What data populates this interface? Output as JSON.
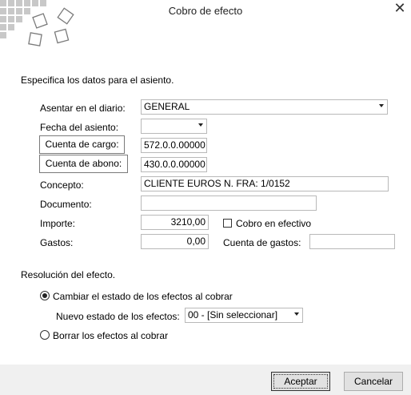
{
  "window": {
    "title": "Cobro de efecto",
    "close_icon": "close-icon"
  },
  "section1": {
    "heading": "Especifica los datos para el asiento."
  },
  "form": {
    "diario": {
      "label": "Asentar en el diario:",
      "value": "GENERAL"
    },
    "fecha": {
      "label": "Fecha del asiento:",
      "value": ""
    },
    "cargo": {
      "label": "Cuenta de cargo:",
      "value": "572.0.0.00000"
    },
    "abono": {
      "label": "Cuenta de abono:",
      "value": "430.0.0.00000"
    },
    "concepto": {
      "label": "Concepto:",
      "value": "CLIENTE EUROS N. FRA: 1/0152"
    },
    "documento": {
      "label": "Documento:",
      "value": ""
    },
    "importe": {
      "label": "Importe:",
      "value": "3210,00"
    },
    "cobro_efectivo": {
      "label": "Cobro en efectivo",
      "checked": false
    },
    "gastos": {
      "label": "Gastos:",
      "value": "0,00"
    },
    "cuenta_gastos": {
      "label": "Cuenta de gastos:",
      "value": ""
    }
  },
  "section2": {
    "heading": "Resolución del efecto.",
    "option_change": {
      "label": "Cambiar el estado de los efectos al cobrar",
      "selected": true
    },
    "nuevo_estado": {
      "label": "Nuevo estado de los efectos:",
      "value": "00 - [Sin seleccionar]"
    },
    "option_delete": {
      "label": "Borrar los efectos al cobrar",
      "selected": false
    }
  },
  "footer": {
    "accept": "Aceptar",
    "cancel": "Cancelar"
  }
}
